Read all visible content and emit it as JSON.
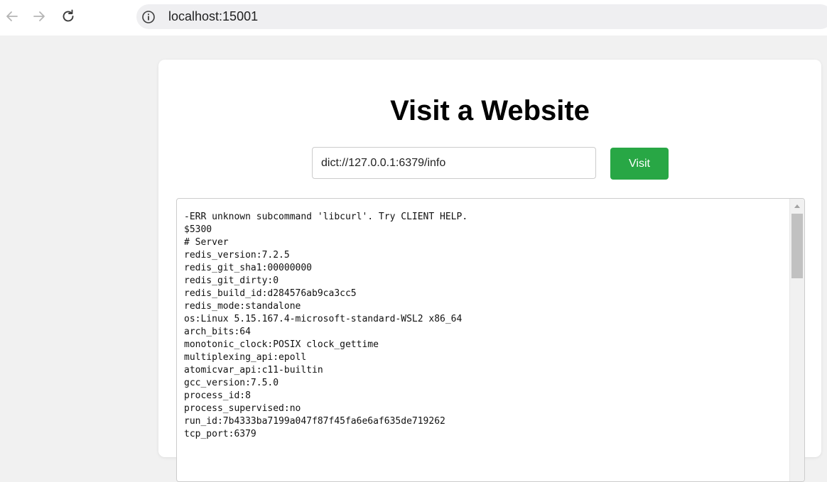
{
  "browser": {
    "url": "localhost:15001",
    "icons": {
      "back": "arrow-left-icon",
      "forward": "arrow-right-icon",
      "reload": "reload-icon",
      "site_info": "info-icon"
    }
  },
  "page": {
    "title": "Visit a Website",
    "input_value": "dict://127.0.0.1:6379/info",
    "visit_label": "Visit",
    "accent_color": "#28a745"
  },
  "result": {
    "lines": [
      "-ERR unknown subcommand 'libcurl'. Try CLIENT HELP.",
      "$5300",
      "# Server",
      "redis_version:7.2.5",
      "redis_git_sha1:00000000",
      "redis_git_dirty:0",
      "redis_build_id:d284576ab9ca3cc5",
      "redis_mode:standalone",
      "os:Linux 5.15.167.4-microsoft-standard-WSL2 x86_64",
      "arch_bits:64",
      "monotonic_clock:POSIX clock_gettime",
      "multiplexing_api:epoll",
      "atomicvar_api:c11-builtin",
      "gcc_version:7.5.0",
      "process_id:8",
      "process_supervised:no",
      "run_id:7b4333ba7199a047f87f45fa6e6af635de719262",
      "tcp_port:6379"
    ]
  }
}
